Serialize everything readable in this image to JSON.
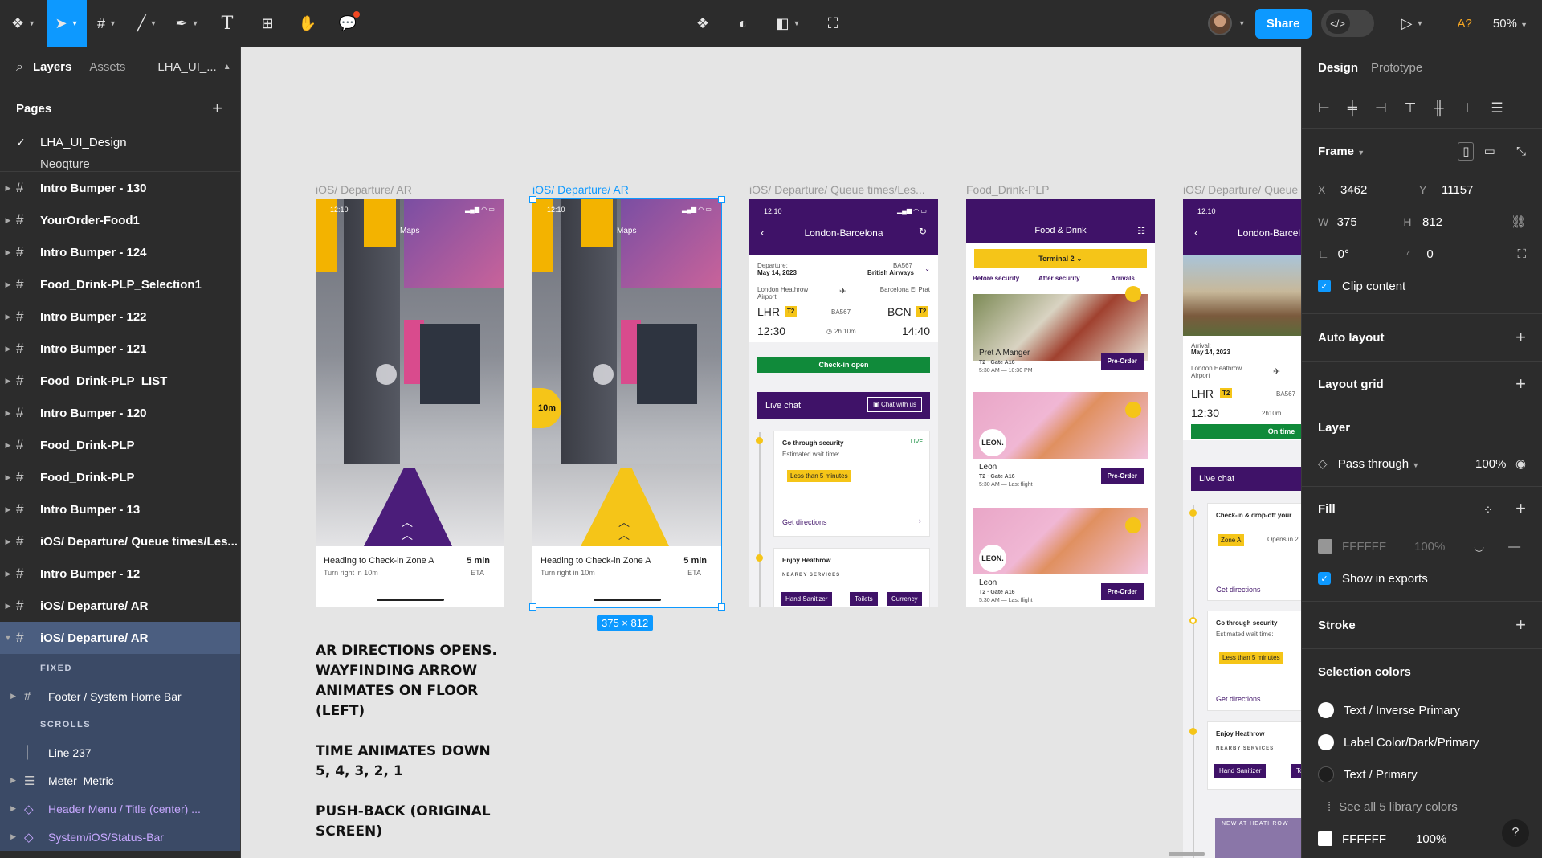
{
  "toolbar": {
    "share_label": "Share",
    "dev_mode_icon": "</>",
    "accessibility_label": "A?",
    "zoom": "50%"
  },
  "left_panel": {
    "tabs": {
      "layers": "Layers",
      "assets": "Assets",
      "file": "LHA_UI_..."
    },
    "pages_title": "Pages",
    "pages": [
      "LHA_UI_Design",
      "Neoqture"
    ],
    "layers": [
      "Intro Bumper - 130",
      "YourOrder-Food1",
      "Intro Bumper - 124",
      "Food_Drink-PLP_Selection1",
      "Intro Bumper - 122",
      "Intro Bumper - 121",
      "Food_Drink-PLP_LIST",
      "Intro Bumper - 120",
      "Food_Drink-PLP",
      "Food_Drink-PLP",
      "Intro Bumper - 13",
      "iOS/ Departure/ Queue times/Les...",
      "Intro Bumper - 12",
      "iOS/ Departure/ AR",
      "iOS/ Departure/ AR"
    ],
    "children": {
      "fixed_label": "FIXED",
      "footer": "Footer / System Home Bar",
      "scrolls_label": "SCROLLS",
      "line": "Line 237",
      "meter": "Meter_Metric",
      "header_menu": "Header Menu / Title (center) ...",
      "status_bar": "System/iOS/Status-Bar"
    }
  },
  "canvas": {
    "frame_labels": [
      "iOS/ Departure/ AR",
      "iOS/ Departure/ AR",
      "iOS/ Departure/ Queue times/Les...",
      "Food_Drink-PLP",
      "iOS/ Departure/ Queue"
    ],
    "size_badge": "375 × 812",
    "ar": {
      "time": "12:10",
      "maps": "Maps",
      "badge": "10m",
      "heading": "Heading to Check-in Zone A",
      "turn": "Turn right in 10m",
      "eta_value": "5 min",
      "eta_label": "ETA"
    },
    "flight": {
      "time": "12:10",
      "title": "London-Barcelona",
      "departure_label": "Departure:",
      "departure_date": "May 14, 2023",
      "flight_no": "BA567",
      "airline": "British Airways",
      "from_airport": "London Heathrow Airport",
      "to_airport": "Barcelona El Prat",
      "from_code": "LHR",
      "to_code": "BCN",
      "terminal": "T2",
      "dep_time": "12:30",
      "duration": "2h 10m",
      "arr_time": "14:40",
      "checkin": "Check-in open",
      "live_chat": "Live chat",
      "chat_with_us": "Chat with us",
      "security_title": "Go through security",
      "live": "LIVE",
      "wait_label": "Estimated wait time:",
      "wait_value": "Less than 5 minutes",
      "directions": "Get directions",
      "enjoy": "Enjoy Heathrow",
      "nearby": "NEARBY SERVICES",
      "services": [
        "Hand Sanitizer",
        "Toilets",
        "Currency"
      ]
    },
    "food": {
      "title": "Food & Drink",
      "terminal": "Terminal 2",
      "tabs": [
        "Before security",
        "After security",
        "Arrivals"
      ],
      "items": [
        {
          "name": "Pret A Manger",
          "gate": "T2 · Gate A16",
          "hours": "5:30 AM — 10:30 PM",
          "cta": "Pre-Order"
        },
        {
          "name": "Leon",
          "gate": "T2 · Gate A16",
          "hours": "5:30 AM — Last flight",
          "cta": "Pre-Order"
        },
        {
          "name": "Leon",
          "gate": "T2 · Gate A16",
          "hours": "5:30 AM — Last flight",
          "cta": "Pre-Order"
        }
      ],
      "leon_logo": "LEON."
    },
    "queue": {
      "time": "12:10",
      "title": "London-Barcel",
      "arrival_label": "Arrival:",
      "arrival_date": "May 14, 2023",
      "airport": "London Heathrow Airport",
      "code": "LHR",
      "terminal": "T2",
      "flight_no": "BA567",
      "dep_time": "12:30",
      "duration": "2h10m",
      "on_time": "On time",
      "live_chat": "Live chat",
      "checkin_title": "Check-in & drop-off your",
      "zone": "Zone A",
      "opens": "Opens in 2",
      "directions": "Get directions",
      "security_title": "Go through security",
      "wait_label": "Estimated wait time:",
      "wait_value": "Less than 5 minutes",
      "directions2": "Get directions",
      "enjoy": "Enjoy Heathrow",
      "nearby": "NEARBY SERVICES",
      "svc1": "Hand Sanitizer",
      "svc2": "Toile",
      "new_at": "NEW AT HEATHROW"
    },
    "notes": [
      "AR DIRECTIONS OPENS. WAYFINDING ARROW ANIMATES ON FLOOR (LEFT)",
      "TIME ANIMATES DOWN 5, 4, 3, 2, 1",
      "PUSH-BACK (ORIGINAL SCREEN)"
    ]
  },
  "right_panel": {
    "tabs": {
      "design": "Design",
      "prototype": "Prototype"
    },
    "frame": {
      "title": "Frame",
      "x_label": "X",
      "x": "3462",
      "y_label": "Y",
      "y": "11157",
      "w_label": "W",
      "w": "375",
      "h_label": "H",
      "h": "812",
      "rotation": "0°",
      "radius": "0",
      "clip": "Clip content"
    },
    "auto_layout": "Auto layout",
    "layout_grid": "Layout grid",
    "layer": {
      "title": "Layer",
      "blend": "Pass through",
      "opacity": "100%"
    },
    "fill": {
      "title": "Fill",
      "hex": "FFFFFF",
      "opacity": "100%",
      "show_exports": "Show in exports"
    },
    "stroke": "Stroke",
    "selection_colors": {
      "title": "Selection colors",
      "items": [
        {
          "name": "Text / Inverse Primary",
          "color": "#ffffff"
        },
        {
          "name": "Label Color/Dark/Primary",
          "color": "#ffffff"
        },
        {
          "name": "Text / Primary",
          "color": "#1e1e1e"
        }
      ],
      "see_all": "See all 5 library colors",
      "hex": "FFFFFF",
      "opacity": "100%"
    }
  },
  "colors": {
    "accent": "#0d99ff",
    "heathrow_purple": "#3f1268",
    "heathrow_yellow": "#f5c518"
  }
}
